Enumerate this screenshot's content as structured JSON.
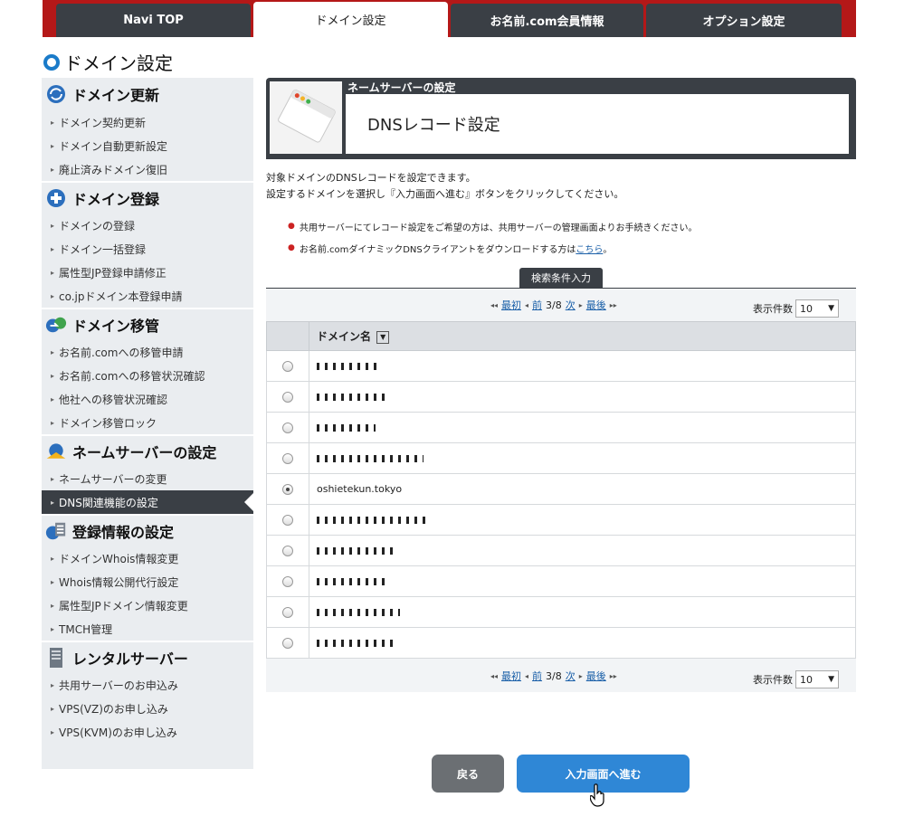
{
  "tabs": [
    {
      "label": "Navi TOP",
      "active": false
    },
    {
      "label": "ドメイン設定",
      "active": true
    },
    {
      "label": "お名前.com会員情報",
      "active": false
    },
    {
      "label": "オプション設定",
      "active": false
    }
  ],
  "page_title": "ドメイン設定",
  "sidebar": [
    {
      "title": "ドメイン更新",
      "icon": "refresh-globe-icon",
      "items": [
        "ドメイン契約更新",
        "ドメイン自動更新設定",
        "廃止済みドメイン復旧"
      ]
    },
    {
      "title": "ドメイン登録",
      "icon": "plus-circle-icon",
      "items": [
        "ドメインの登録",
        "ドメイン一括登録",
        "属性型JP登録申請修正",
        "co.jpドメイン本登録申請"
      ]
    },
    {
      "title": "ドメイン移管",
      "icon": "transfer-globe-icon",
      "items": [
        "お名前.comへの移管申請",
        "お名前.comへの移管状況確認",
        "他社への移管状況確認",
        "ドメイン移管ロック"
      ]
    },
    {
      "title": "ネームサーバーの設定",
      "icon": "nameserver-globe-icon",
      "items": [
        "ネームサーバーの変更",
        "DNS関連機能の設定"
      ],
      "active_item": 1
    },
    {
      "title": "登録情報の設定",
      "icon": "registration-info-icon",
      "items": [
        "ドメインWhois情報変更",
        "Whois情報公開代行設定",
        "属性型JPドメイン情報変更",
        "TMCH管理"
      ]
    },
    {
      "title": "レンタルサーバー",
      "icon": "server-icon",
      "items": [
        "共用サーバーのお申込み",
        "VPS(VZ)のお申し込み",
        "VPS(KVM)のお申し込み"
      ]
    }
  ],
  "header": {
    "small": "ネームサーバーの設定",
    "title": "DNSレコード設定"
  },
  "description": [
    "対象ドメインのDNSレコードを設定できます。",
    "設定するドメインを選択し『入力画面へ進む』ボタンをクリックしてください。"
  ],
  "notes": [
    {
      "text": "共用サーバーにてレコード設定をご希望の方は、共用サーバーの管理画面よりお手続きください。",
      "link": ""
    },
    {
      "text": "お名前.comダイナミックDNSクライアントをダウンロードする方は",
      "link": "こちら",
      "suffix": "。"
    }
  ],
  "search_tab": "検索条件入力",
  "pager": {
    "first": "最初",
    "prev": "前",
    "position": "3/8",
    "next": "次",
    "last": "最後",
    "count_label": "表示件数",
    "count_value": "10"
  },
  "table": {
    "header": "ドメイン名",
    "rows": [
      {
        "domain": "",
        "masked": true,
        "selected": false
      },
      {
        "domain": "",
        "masked": true,
        "selected": false
      },
      {
        "domain": "",
        "masked": true,
        "selected": false
      },
      {
        "domain": "",
        "masked": true,
        "selected": false
      },
      {
        "domain": "oshietekun.tokyo",
        "masked": false,
        "selected": true
      },
      {
        "domain": "",
        "masked": true,
        "selected": false
      },
      {
        "domain": "",
        "masked": true,
        "selected": false
      },
      {
        "domain": "",
        "masked": true,
        "selected": false
      },
      {
        "domain": "",
        "masked": true,
        "selected": false
      },
      {
        "domain": "",
        "masked": true,
        "selected": false
      }
    ]
  },
  "buttons": {
    "back": "戻る",
    "next": "入力画面へ進む"
  }
}
